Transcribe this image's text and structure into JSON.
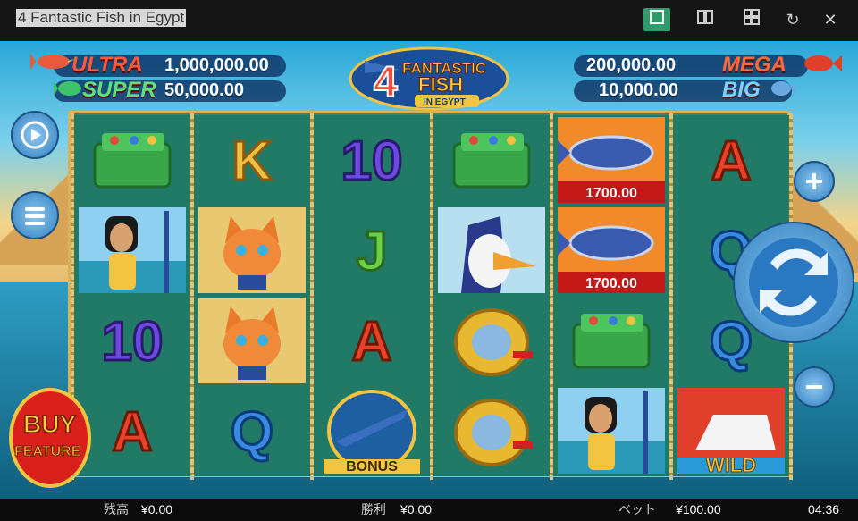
{
  "window": {
    "title": "4 Fantastic Fish in Egypt",
    "buttons": [
      "single-view",
      "split-view",
      "grid-view",
      "refresh",
      "close"
    ]
  },
  "jackpots": {
    "ultra": {
      "name": "ULTRA",
      "value": "1,000,000.00"
    },
    "super": {
      "name": "SUPER",
      "value": "50,000.00"
    },
    "mega": {
      "name": "MEGA",
      "value": "200,000.00"
    },
    "big": {
      "name": "BIG",
      "value": "10,000.00"
    }
  },
  "logo": {
    "number": "4",
    "line1": "FANTASTIC",
    "line2": "FISH",
    "line3": "IN EGYPT"
  },
  "reels": [
    [
      "tacklebox",
      "cleopatra",
      "ten",
      "a"
    ],
    [
      "k",
      "cat",
      "cat",
      "q"
    ],
    [
      "ten",
      "j",
      "a",
      "bonus"
    ],
    [
      "tacklebox",
      "pelican",
      "reel",
      "reel"
    ],
    [
      "tuna",
      "tuna",
      "tacklebox",
      "cleopatra"
    ],
    [
      "a",
      "q",
      "q",
      "wild"
    ]
  ],
  "prize_labels": {
    "r4c0": "1700.00",
    "r4c1": "1700.00"
  },
  "symbol_text": {
    "ten": "10",
    "a": "A",
    "k": "K",
    "q": "Q",
    "j": "J",
    "bonus": "BONUS",
    "wild": "WILD"
  },
  "buy_feature": {
    "line1": "BUY",
    "line2": "FEATURE"
  },
  "status": {
    "balance_label": "残高",
    "balance": "¥0.00",
    "win_label": "勝利",
    "win": "¥0.00",
    "bet_label": "ベット",
    "bet": "¥100.00",
    "clock": "04:36"
  },
  "colors": {
    "accent_green": "#2f9a6a",
    "gold": "#d6b35a",
    "prize_red": "#c21818"
  }
}
